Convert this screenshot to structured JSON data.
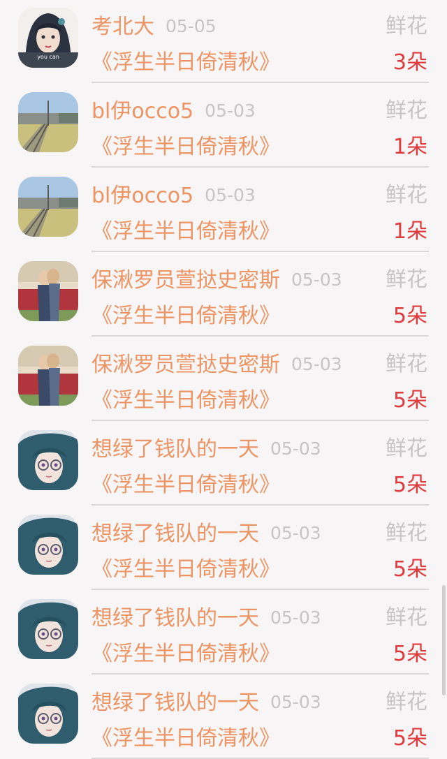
{
  "gift_list": {
    "items": [
      {
        "name": "考北大",
        "date": "05-05",
        "book": "《浮生半日倚清秋》",
        "gift": "鲜花",
        "count": "3朵",
        "avatar": "anime-woman-avatar"
      },
      {
        "name": "bl伊occo5",
        "date": "05-03",
        "book": "《浮生半日倚清秋》",
        "gift": "鲜花",
        "count": "1朵",
        "avatar": "railway-landscape-avatar"
      },
      {
        "name": "bl伊occo5",
        "date": "05-03",
        "book": "《浮生半日倚清秋》",
        "gift": "鲜花",
        "count": "1朵",
        "avatar": "railway-landscape-avatar"
      },
      {
        "name": "保湫罗员萱挞史密斯",
        "date": "05-03",
        "book": "《浮生半日倚清秋》",
        "gift": "鲜花",
        "count": "5朵",
        "avatar": "couple-photo-avatar"
      },
      {
        "name": "保湫罗员萱挞史密斯",
        "date": "05-03",
        "book": "《浮生半日倚清秋》",
        "gift": "鲜花",
        "count": "5朵",
        "avatar": "couple-photo-avatar"
      },
      {
        "name": "想绿了钱队的一天",
        "date": "05-03",
        "book": "《浮生半日倚清秋》",
        "gift": "鲜花",
        "count": "5朵",
        "avatar": "anime-man-glasses-avatar"
      },
      {
        "name": "想绿了钱队的一天",
        "date": "05-03",
        "book": "《浮生半日倚清秋》",
        "gift": "鲜花",
        "count": "5朵",
        "avatar": "anime-man-glasses-avatar"
      },
      {
        "name": "想绿了钱队的一天",
        "date": "05-03",
        "book": "《浮生半日倚清秋》",
        "gift": "鲜花",
        "count": "5朵",
        "avatar": "anime-man-glasses-avatar"
      },
      {
        "name": "想绿了钱队的一天",
        "date": "05-03",
        "book": "《浮生半日倚清秋》",
        "gift": "鲜花",
        "count": "5朵",
        "avatar": "anime-man-glasses-avatar"
      }
    ]
  },
  "colors": {
    "name": "#ec9463",
    "date": "#c7c4c5",
    "gift": "#c7c4c5",
    "count": "#df3b3d",
    "background": "#f7f5f6"
  }
}
